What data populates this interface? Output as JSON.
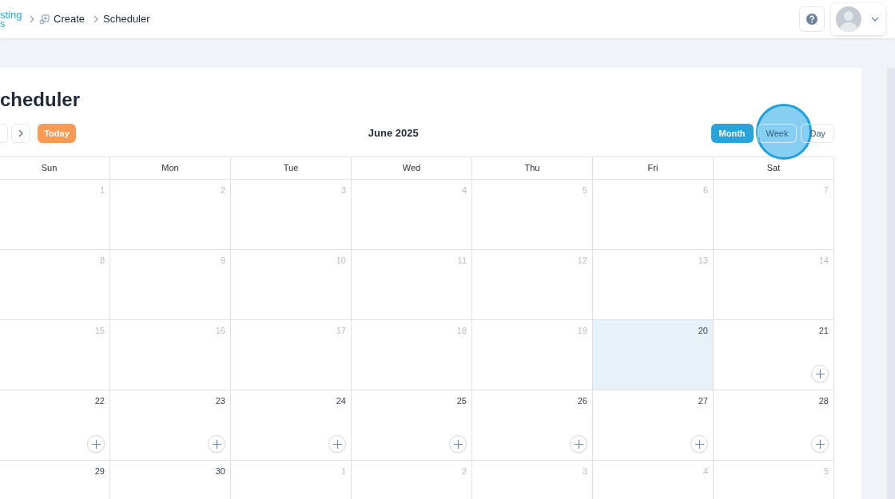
{
  "header": {
    "logo_lines": [
      "sting",
      "s"
    ],
    "breadcrumbs": [
      {
        "label": "Create",
        "icon": true
      },
      {
        "label": "Scheduler",
        "icon": false
      }
    ]
  },
  "page": {
    "title": "cheduler"
  },
  "toolbar": {
    "today": "Today",
    "month_label": "June 2025",
    "views": [
      {
        "label": "Month",
        "selected": true
      },
      {
        "label": "Week",
        "selected": false
      },
      {
        "label": "Day",
        "selected": false
      }
    ]
  },
  "calendar": {
    "weekdays": [
      "Sun",
      "Mon",
      "Tue",
      "Wed",
      "Thu",
      "Fri",
      "Sat"
    ],
    "weeks": [
      [
        {
          "day": "1",
          "muted": true,
          "today": false,
          "add": false
        },
        {
          "day": "2",
          "muted": true,
          "today": false,
          "add": false
        },
        {
          "day": "3",
          "muted": true,
          "today": false,
          "add": false
        },
        {
          "day": "4",
          "muted": true,
          "today": false,
          "add": false
        },
        {
          "day": "5",
          "muted": true,
          "today": false,
          "add": false
        },
        {
          "day": "6",
          "muted": true,
          "today": false,
          "add": false
        },
        {
          "day": "7",
          "muted": true,
          "today": false,
          "add": false
        }
      ],
      [
        {
          "day": "8",
          "muted": true,
          "today": false,
          "add": false
        },
        {
          "day": "9",
          "muted": true,
          "today": false,
          "add": false
        },
        {
          "day": "10",
          "muted": true,
          "today": false,
          "add": false
        },
        {
          "day": "11",
          "muted": true,
          "today": false,
          "add": false
        },
        {
          "day": "12",
          "muted": true,
          "today": false,
          "add": false
        },
        {
          "day": "13",
          "muted": true,
          "today": false,
          "add": false
        },
        {
          "day": "14",
          "muted": true,
          "today": false,
          "add": false
        }
      ],
      [
        {
          "day": "15",
          "muted": true,
          "today": false,
          "add": false
        },
        {
          "day": "16",
          "muted": true,
          "today": false,
          "add": false
        },
        {
          "day": "17",
          "muted": true,
          "today": false,
          "add": false
        },
        {
          "day": "18",
          "muted": true,
          "today": false,
          "add": false
        },
        {
          "day": "19",
          "muted": true,
          "today": false,
          "add": false
        },
        {
          "day": "20",
          "muted": false,
          "today": true,
          "add": false
        },
        {
          "day": "21",
          "muted": false,
          "today": false,
          "add": true
        }
      ],
      [
        {
          "day": "22",
          "muted": false,
          "today": false,
          "add": true
        },
        {
          "day": "23",
          "muted": false,
          "today": false,
          "add": true
        },
        {
          "day": "24",
          "muted": false,
          "today": false,
          "add": true
        },
        {
          "day": "25",
          "muted": false,
          "today": false,
          "add": true
        },
        {
          "day": "26",
          "muted": false,
          "today": false,
          "add": true
        },
        {
          "day": "27",
          "muted": false,
          "today": false,
          "add": true
        },
        {
          "day": "28",
          "muted": false,
          "today": false,
          "add": true
        }
      ],
      [
        {
          "day": "29",
          "muted": false,
          "today": false,
          "add": false
        },
        {
          "day": "30",
          "muted": false,
          "today": false,
          "add": false
        },
        {
          "day": "1",
          "muted": true,
          "today": false,
          "add": false
        },
        {
          "day": "2",
          "muted": true,
          "today": false,
          "add": false
        },
        {
          "day": "3",
          "muted": true,
          "today": false,
          "add": false
        },
        {
          "day": "4",
          "muted": true,
          "today": false,
          "add": false
        },
        {
          "day": "5",
          "muted": true,
          "today": false,
          "add": false
        }
      ]
    ]
  }
}
